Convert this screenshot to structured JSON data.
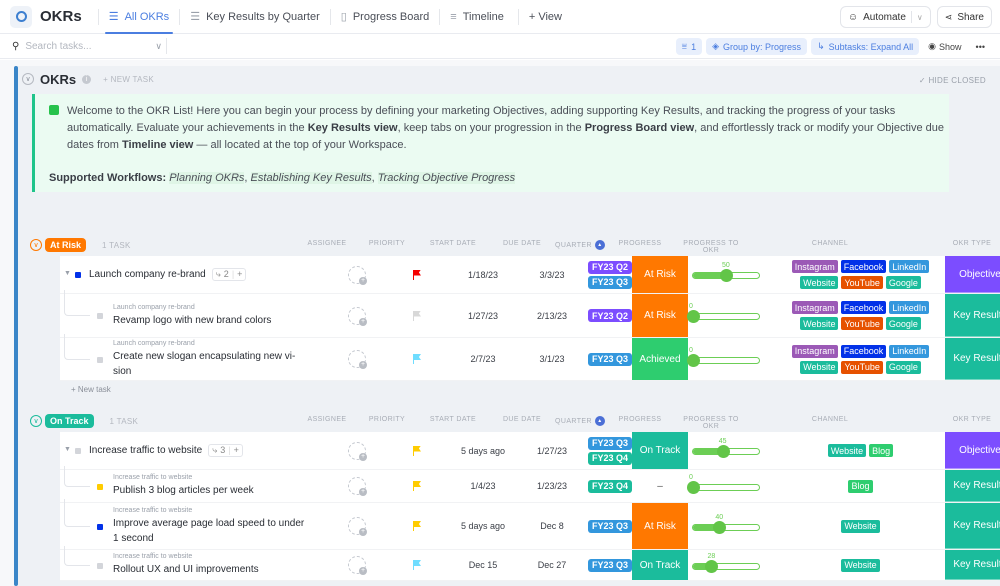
{
  "header": {
    "app_title": "OKRs",
    "tabs": [
      {
        "label": "All OKRs",
        "icon": "list-icon",
        "active": true
      },
      {
        "label": "Key Results by Quarter",
        "icon": "list-icon",
        "active": false
      },
      {
        "label": "Progress Board",
        "icon": "board-icon",
        "active": false
      },
      {
        "label": "Timeline",
        "icon": "timeline-icon",
        "active": false
      }
    ],
    "add_view_label": "+ View",
    "automate_label": "Automate",
    "share_label": "Share"
  },
  "toolbar": {
    "search_placeholder": "Search tasks...",
    "filter_count": "1",
    "group_by_label": "Group by: Progress",
    "subtasks_label": "Subtasks: Expand All",
    "show_label": "Show",
    "more_label": "•••"
  },
  "list": {
    "title": "OKRs",
    "new_task_label": "+ NEW TASK",
    "hide_closed_label": "HIDE CLOSED",
    "description": {
      "p1_a": "Welcome to the OKR List! Here you can begin your process by defining your marketing Objectives, adding supporting Key Results, and tracking the progress of your tasks automatically. Evaluate your achievements in the ",
      "p1_b": "Key Results view",
      "p1_c": ", keep tabs on your progression in the ",
      "p1_d": "Progress Board view",
      "p1_e": ", and effortlessly track or modify your Objective due dates from ",
      "p1_f": "Timeline view",
      "p1_g": " — all located at the top of your Workspace.",
      "wf_label": "Supported Workflows:",
      "wf1": "Planning OKRs",
      "wf2": "Establishing Key Results",
      "wf3": "Tracking Objective Progress"
    }
  },
  "columns": {
    "assignee": "ASSIGNEE",
    "priority": "PRIORITY",
    "start_date": "START DATE",
    "due_date": "DUE DATE",
    "quarter": "QUARTER",
    "progress": "PROGRESS",
    "progress_to_okr": "PROGRESS TO OKR",
    "channel": "CHANNEL",
    "okr_type": "OKR TYPE"
  },
  "colors": {
    "at_risk": "#ff7800",
    "on_track": "#1bbc9c",
    "achieved": "#2ecd6f",
    "objective": "#7c4dff",
    "key_results": "#1bbc9c",
    "q2": "#7c4dff",
    "q3": "#3397dd",
    "q4": "#1bbc9c",
    "instagram": "#9b59b6",
    "facebook": "#0231e8",
    "linkedin": "#3397dd",
    "website": "#1bbc9c",
    "youtube": "#e65100",
    "google": "#1bbc9c",
    "blog": "#2ecd6f",
    "flag_urgent": "#f50000",
    "flag_high": "#ffcc00",
    "flag_normal": "#6fddff",
    "flag_low": "#d8d8d8"
  },
  "groups": [
    {
      "status": "At Risk",
      "status_color": "#ff7800",
      "count_label": "1 TASK",
      "new_task_label": "+ New task",
      "tasks": [
        {
          "parent": "",
          "title": "Launch company re-brand",
          "title2": "",
          "subtasks": "2",
          "status_color": "#0231e8",
          "priority": "urgent",
          "start": "1/18/23",
          "due": "3/3/23",
          "quarters": [
            "FY23 Q2",
            "FY23 Q3"
          ],
          "progress": "At Risk",
          "progress_pct": 50,
          "channels": [
            "Instagram",
            "Facebook",
            "LinkedIn",
            "Website",
            "YouTube",
            "Google"
          ],
          "okr_type": "Objective"
        },
        {
          "parent": "Launch company re-brand",
          "title": "Revamp logo with new brand colors",
          "title2": "",
          "status_color": "#d3d5da",
          "priority": "low",
          "start": "1/27/23",
          "due": "2/13/23",
          "quarters": [
            "FY23 Q2"
          ],
          "progress": "At Risk",
          "progress_pct": 0,
          "channels": [
            "Instagram",
            "Facebook",
            "LinkedIn",
            "Website",
            "YouTube",
            "Google"
          ],
          "okr_type": "Key Results"
        },
        {
          "parent": "Launch company re-brand",
          "title": "Create new slogan encapsulating new vi-",
          "title2": "sion",
          "status_color": "#d3d5da",
          "priority": "normal",
          "start": "2/7/23",
          "due": "3/1/23",
          "quarters": [
            "FY23 Q3"
          ],
          "progress": "Achieved",
          "progress_pct": 0,
          "channels": [
            "Instagram",
            "Facebook",
            "LinkedIn",
            "Website",
            "YouTube",
            "Google"
          ],
          "okr_type": "Key Results"
        }
      ]
    },
    {
      "status": "On Track",
      "status_color": "#1bbc9c",
      "count_label": "1 TASK",
      "tasks": [
        {
          "parent": "",
          "title": "Increase traffic to website",
          "title2": "",
          "subtasks": "3",
          "status_color": "#d3d5da",
          "priority": "high",
          "start": "5 days ago",
          "due": "1/27/23",
          "quarters": [
            "FY23 Q3",
            "FY23 Q4"
          ],
          "progress": "On Track",
          "progress_pct": 45,
          "channels": [
            "Website",
            "Blog"
          ],
          "okr_type": "Objective"
        },
        {
          "parent": "Increase traffic to website",
          "title": "Publish 3 blog articles per week",
          "title2": "",
          "status_color": "#ffcc00",
          "priority": "high",
          "start": "1/4/23",
          "due": "1/23/23",
          "quarters": [
            "FY23 Q4"
          ],
          "progress": "–",
          "progress_pct": 0,
          "channels": [
            "Blog"
          ],
          "okr_type": "Key Results"
        },
        {
          "parent": "Increase traffic to website",
          "title": "Improve average page load speed to under",
          "title2": "1 second",
          "status_color": "#0231e8",
          "priority": "high",
          "start": "5 days ago",
          "due": "Dec 8",
          "quarters": [
            "FY23 Q3"
          ],
          "progress": "At Risk",
          "progress_pct": 40,
          "channels": [
            "Website"
          ],
          "okr_type": "Key Results"
        },
        {
          "parent": "Increase traffic to website",
          "title": "Rollout UX and UI improvements",
          "title2": "",
          "status_color": "#d3d5da",
          "priority": "normal",
          "start": "Dec 15",
          "due": "Dec 27",
          "quarters": [
            "FY23 Q3"
          ],
          "progress": "On Track",
          "progress_pct": 28,
          "channels": [
            "Website"
          ],
          "okr_type": "Key Results"
        }
      ]
    }
  ]
}
